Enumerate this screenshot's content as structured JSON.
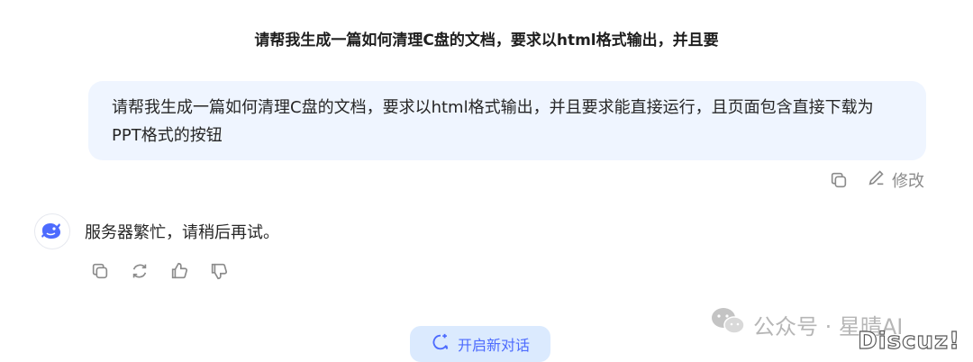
{
  "chat": {
    "title": "请帮我生成一篇如何清理C盘的文档，要求以html格式输出，并且要"
  },
  "user_message": {
    "text": "请帮我生成一篇如何清理C盘的文档，要求以html格式输出，并且要求能直接运行，且页面包含直接下载为PPT格式的按钮",
    "actions": {
      "copy_icon": "copy-icon",
      "edit_label": "修改"
    }
  },
  "assistant_message": {
    "text": "服务器繁忙，请稍后再试。",
    "avatar_icon": "whale-icon",
    "actions": [
      "copy-icon",
      "refresh-icon",
      "thumbs-up-icon",
      "thumbs-down-icon"
    ]
  },
  "new_chat_button": {
    "label": "开启新对话"
  },
  "watermark": {
    "text": "公众号 · 星晴AI",
    "forum_text": "Discuz!"
  },
  "colors": {
    "accent": "#4d6bfe",
    "bubble_bg": "#eff5ff",
    "icon_gray": "#8b8b8b",
    "new_chat_bg": "#dbeafe"
  }
}
